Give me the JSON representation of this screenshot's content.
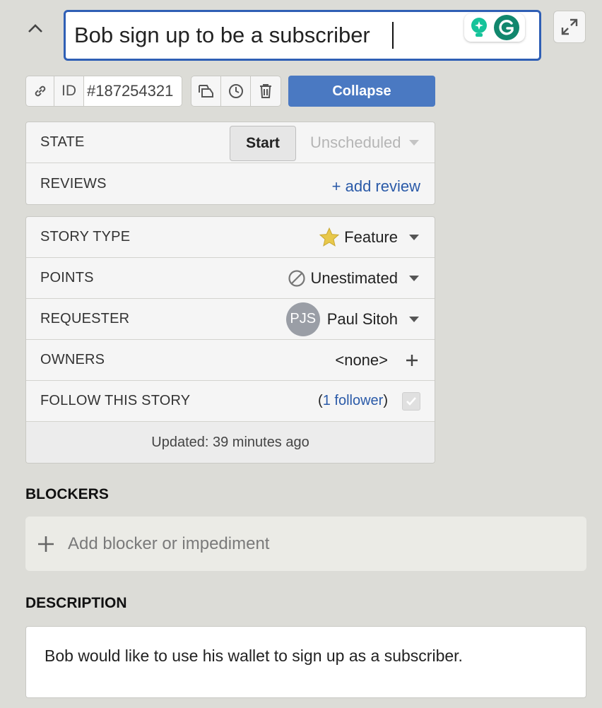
{
  "title": {
    "value": "Bob sign up to be a subscriber"
  },
  "grammarly": {
    "primary_color": "#15c39a",
    "logo_color": "#11876d"
  },
  "toolbar": {
    "id_label": "ID",
    "id_value": "#187254321",
    "collapse_label": "Collapse"
  },
  "state_panel": {
    "state_label": "STATE",
    "start_label": "Start",
    "state_value": "Unscheduled",
    "reviews_label": "REVIEWS",
    "add_review_label": "+ add review"
  },
  "details_panel": {
    "story_type_label": "STORY TYPE",
    "story_type_value": "Feature",
    "points_label": "POINTS",
    "points_value": "Unestimated",
    "requester_label": "REQUESTER",
    "requester_initials": "PJS",
    "requester_name": "Paul Sitoh",
    "owners_label": "OWNERS",
    "owners_value": "<none>",
    "follow_label": "FOLLOW THIS STORY",
    "follower_open": "(",
    "follower_link": "1 follower",
    "follower_close": ")",
    "updated_text": "Updated: 39 minutes ago"
  },
  "blockers": {
    "heading": "BLOCKERS",
    "placeholder": "Add blocker or impediment"
  },
  "description": {
    "heading": "DESCRIPTION",
    "text": "Bob would like to use his wallet to sign up as a subscriber."
  },
  "colors": {
    "accent": "#4a79c2",
    "link": "#2a5aa8",
    "title_border": "#2f5fb5",
    "star": "#e8c84a"
  }
}
